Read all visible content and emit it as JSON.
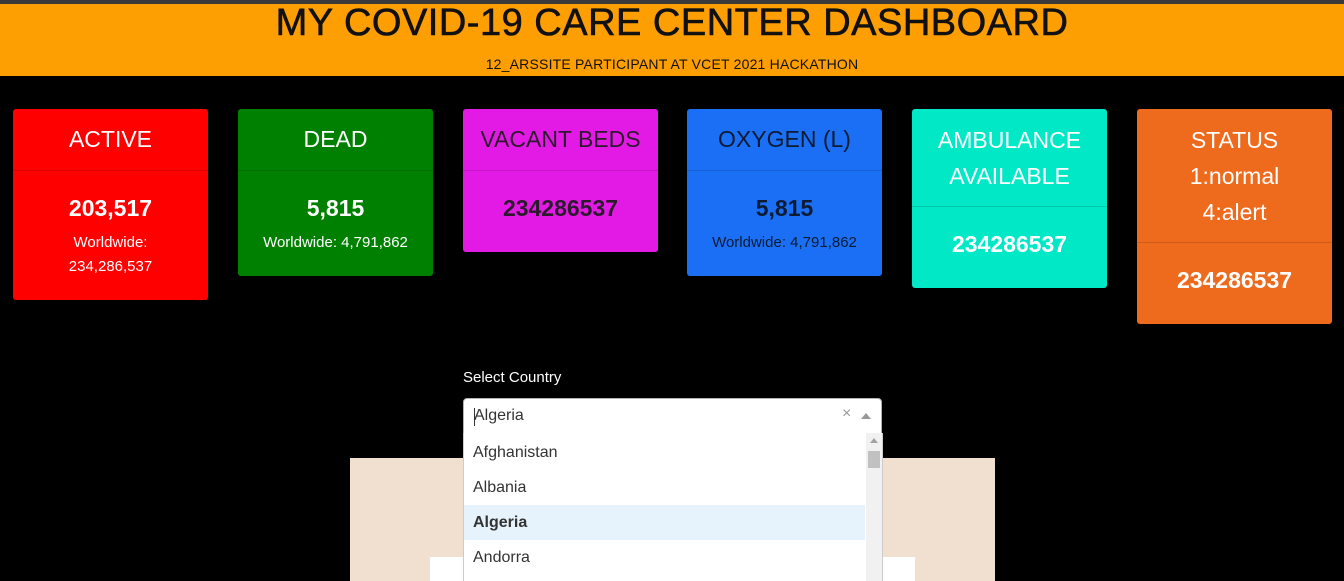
{
  "header": {
    "title": "MY COVID-19 CARE CENTER DASHBOARD",
    "subtitle": "12_ARSSITE PARTICIPANT AT VCET 2021 HACKATHON"
  },
  "cards": {
    "active": {
      "title": "ACTIVE",
      "value": "203,517",
      "worldwide_label": "Worldwide:",
      "worldwide_value": "234,286,537",
      "color": "#ff0000"
    },
    "dead": {
      "title": "DEAD",
      "value": "5,815",
      "worldwide": "Worldwide: 4,791,862",
      "color": "#008000"
    },
    "vacant_beds": {
      "title": "VACANT BEDS",
      "value": "234286537",
      "color": "#e31ae6"
    },
    "oxygen": {
      "title": "OXYGEN (L)",
      "value": "5,815",
      "worldwide": "Worldwide: 4,791,862",
      "color": "#1a6ff5"
    },
    "ambulance": {
      "title_line1": "AMBULANCE",
      "title_line2": "AVAILABLE",
      "value": "234286537",
      "color": "#00e8c6"
    },
    "status": {
      "title_line1": "STATUS",
      "title_line2": "1:normal",
      "title_line3": "4:alert",
      "value": "234286537",
      "color": "#ee6a1d"
    }
  },
  "country_select": {
    "label": "Select Country",
    "selected": "Algeria",
    "clear_symbol": "×",
    "options": [
      "Afghanistan",
      "Albania",
      "Algeria",
      "Andorra"
    ]
  }
}
